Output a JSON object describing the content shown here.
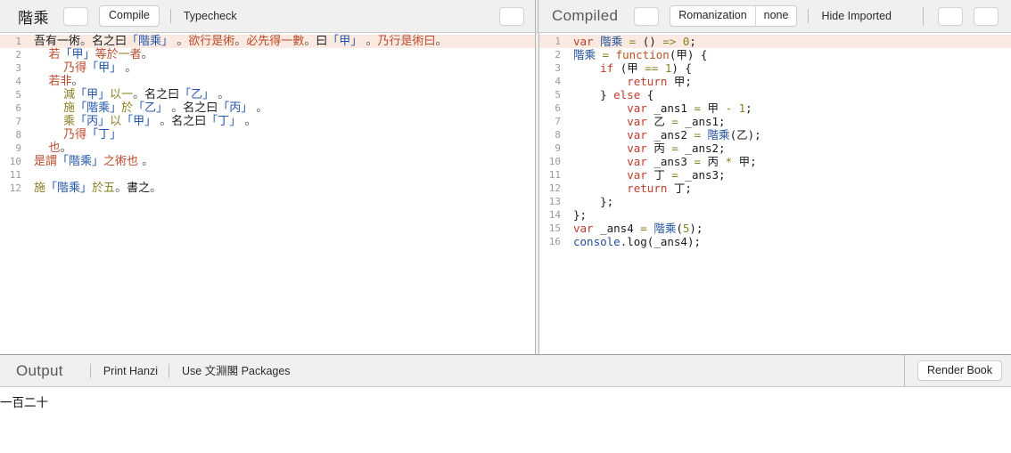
{
  "toolbar_left": {
    "doc_title": "階乘",
    "blank_button": "",
    "compile_label": "Compile",
    "typecheck_label": "Typecheck",
    "right_blank_button": ""
  },
  "toolbar_right": {
    "panel_title": "Compiled",
    "blank_button": "",
    "romanization_label": "Romanization",
    "romanization_value": "none",
    "hide_imported_label": "Hide Imported",
    "blank_button_2": "",
    "blank_button_3": ""
  },
  "left_editor": {
    "active_line": 1,
    "lines": [
      {
        "n": "1",
        "tokens": [
          {
            "t": "吾有一術",
            "c": "pl"
          },
          {
            "t": "。",
            "c": "punc"
          },
          {
            "t": "名之曰",
            "c": "pl"
          },
          {
            "t": "「階乘」",
            "c": "id"
          },
          {
            "t": " 。",
            "c": "punc"
          },
          {
            "t": "欲行是術",
            "c": "kw"
          },
          {
            "t": "。",
            "c": "punc"
          },
          {
            "t": "必先得一數",
            "c": "kw"
          },
          {
            "t": "。",
            "c": "punc"
          },
          {
            "t": "曰",
            "c": "pl"
          },
          {
            "t": "「甲」",
            "c": "id"
          },
          {
            "t": " 。",
            "c": "punc"
          },
          {
            "t": "乃行是術曰",
            "c": "kw"
          },
          {
            "t": "。",
            "c": "punc"
          }
        ]
      },
      {
        "n": "2",
        "tokens": [
          {
            "t": "    ",
            "c": "pl"
          },
          {
            "t": "若",
            "c": "kw"
          },
          {
            "t": "「甲」",
            "c": "id"
          },
          {
            "t": "等於",
            "c": "kw"
          },
          {
            "t": "一",
            "c": "num"
          },
          {
            "t": "者",
            "c": "kw"
          },
          {
            "t": "。",
            "c": "punc"
          }
        ]
      },
      {
        "n": "3",
        "tokens": [
          {
            "t": "        ",
            "c": "pl"
          },
          {
            "t": "乃得",
            "c": "kw"
          },
          {
            "t": "「甲」",
            "c": "id"
          },
          {
            "t": " 。",
            "c": "punc"
          }
        ]
      },
      {
        "n": "4",
        "tokens": [
          {
            "t": "    ",
            "c": "pl"
          },
          {
            "t": "若非",
            "c": "kw"
          },
          {
            "t": "。",
            "c": "punc"
          }
        ]
      },
      {
        "n": "5",
        "tokens": [
          {
            "t": "        ",
            "c": "pl"
          },
          {
            "t": "減",
            "c": "kw2"
          },
          {
            "t": "「甲」",
            "c": "id"
          },
          {
            "t": "以",
            "c": "kw2"
          },
          {
            "t": "一",
            "c": "num"
          },
          {
            "t": "。",
            "c": "punc"
          },
          {
            "t": "名之曰",
            "c": "pl"
          },
          {
            "t": "「乙」",
            "c": "id"
          },
          {
            "t": " 。",
            "c": "punc"
          }
        ]
      },
      {
        "n": "6",
        "tokens": [
          {
            "t": "        ",
            "c": "pl"
          },
          {
            "t": "施",
            "c": "kw2"
          },
          {
            "t": "「階乘」",
            "c": "id"
          },
          {
            "t": "於",
            "c": "kw2"
          },
          {
            "t": "「乙」",
            "c": "id"
          },
          {
            "t": " 。",
            "c": "punc"
          },
          {
            "t": "名之曰",
            "c": "pl"
          },
          {
            "t": "「丙」",
            "c": "id"
          },
          {
            "t": " 。",
            "c": "punc"
          }
        ]
      },
      {
        "n": "7",
        "tokens": [
          {
            "t": "        ",
            "c": "pl"
          },
          {
            "t": "乘",
            "c": "kw2"
          },
          {
            "t": "「丙」",
            "c": "id"
          },
          {
            "t": "以",
            "c": "kw2"
          },
          {
            "t": "「甲」",
            "c": "id"
          },
          {
            "t": " 。",
            "c": "punc"
          },
          {
            "t": "名之曰",
            "c": "pl"
          },
          {
            "t": "「丁」",
            "c": "id"
          },
          {
            "t": " 。",
            "c": "punc"
          }
        ]
      },
      {
        "n": "8",
        "tokens": [
          {
            "t": "        ",
            "c": "pl"
          },
          {
            "t": "乃得",
            "c": "kw"
          },
          {
            "t": "「丁」",
            "c": "id"
          }
        ]
      },
      {
        "n": "9",
        "tokens": [
          {
            "t": "    ",
            "c": "pl"
          },
          {
            "t": "也",
            "c": "kw"
          },
          {
            "t": "。",
            "c": "punc"
          }
        ]
      },
      {
        "n": "10",
        "tokens": [
          {
            "t": "是謂",
            "c": "kw"
          },
          {
            "t": "「階乘」",
            "c": "id"
          },
          {
            "t": "之術也",
            "c": "kw"
          },
          {
            "t": " 。",
            "c": "punc"
          }
        ]
      },
      {
        "n": "11",
        "tokens": []
      },
      {
        "n": "12",
        "tokens": [
          {
            "t": "施",
            "c": "kw2"
          },
          {
            "t": "「階乘」",
            "c": "id"
          },
          {
            "t": "於",
            "c": "kw2"
          },
          {
            "t": "五",
            "c": "num"
          },
          {
            "t": "。",
            "c": "punc"
          },
          {
            "t": "書之",
            "c": "pl"
          },
          {
            "t": "。",
            "c": "punc"
          }
        ]
      }
    ]
  },
  "right_editor": {
    "active_line": 1,
    "lines": [
      {
        "n": "1",
        "tokens": [
          {
            "t": "var ",
            "c": "kw"
          },
          {
            "t": "階乘",
            "c": "id"
          },
          {
            "t": " ",
            "c": "txt"
          },
          {
            "t": "=",
            "c": "op"
          },
          {
            "t": " () ",
            "c": "txt"
          },
          {
            "t": "=>",
            "c": "op"
          },
          {
            "t": " ",
            "c": "txt"
          },
          {
            "t": "0",
            "c": "num"
          },
          {
            "t": ";",
            "c": "txt"
          }
        ]
      },
      {
        "n": "2",
        "tokens": [
          {
            "t": "階乘",
            "c": "id"
          },
          {
            "t": " ",
            "c": "txt"
          },
          {
            "t": "=",
            "c": "op"
          },
          {
            "t": " ",
            "c": "txt"
          },
          {
            "t": "function",
            "c": "fn"
          },
          {
            "t": "(甲) {",
            "c": "txt"
          }
        ]
      },
      {
        "n": "3",
        "tokens": [
          {
            "t": "    ",
            "c": "txt"
          },
          {
            "t": "if",
            "c": "kw"
          },
          {
            "t": " (甲 ",
            "c": "txt"
          },
          {
            "t": "==",
            "c": "op"
          },
          {
            "t": " ",
            "c": "txt"
          },
          {
            "t": "1",
            "c": "num"
          },
          {
            "t": ") {",
            "c": "txt"
          }
        ]
      },
      {
        "n": "4",
        "tokens": [
          {
            "t": "        ",
            "c": "txt"
          },
          {
            "t": "return",
            "c": "kw"
          },
          {
            "t": " 甲;",
            "c": "txt"
          }
        ]
      },
      {
        "n": "5",
        "tokens": [
          {
            "t": "    } ",
            "c": "txt"
          },
          {
            "t": "else",
            "c": "kw"
          },
          {
            "t": " {",
            "c": "txt"
          }
        ]
      },
      {
        "n": "6",
        "tokens": [
          {
            "t": "        ",
            "c": "txt"
          },
          {
            "t": "var",
            "c": "kw"
          },
          {
            "t": " _ans1 ",
            "c": "txt"
          },
          {
            "t": "=",
            "c": "op"
          },
          {
            "t": " 甲 ",
            "c": "txt"
          },
          {
            "t": "-",
            "c": "op"
          },
          {
            "t": " ",
            "c": "txt"
          },
          {
            "t": "1",
            "c": "num"
          },
          {
            "t": ";",
            "c": "txt"
          }
        ]
      },
      {
        "n": "7",
        "tokens": [
          {
            "t": "        ",
            "c": "txt"
          },
          {
            "t": "var",
            "c": "kw"
          },
          {
            "t": " 乙 ",
            "c": "txt"
          },
          {
            "t": "=",
            "c": "op"
          },
          {
            "t": " _ans1;",
            "c": "txt"
          }
        ]
      },
      {
        "n": "8",
        "tokens": [
          {
            "t": "        ",
            "c": "txt"
          },
          {
            "t": "var",
            "c": "kw"
          },
          {
            "t": " _ans2 ",
            "c": "txt"
          },
          {
            "t": "=",
            "c": "op"
          },
          {
            "t": " ",
            "c": "txt"
          },
          {
            "t": "階乘",
            "c": "id"
          },
          {
            "t": "(乙);",
            "c": "txt"
          }
        ]
      },
      {
        "n": "9",
        "tokens": [
          {
            "t": "        ",
            "c": "txt"
          },
          {
            "t": "var",
            "c": "kw"
          },
          {
            "t": " 丙 ",
            "c": "txt"
          },
          {
            "t": "=",
            "c": "op"
          },
          {
            "t": " _ans2;",
            "c": "txt"
          }
        ]
      },
      {
        "n": "10",
        "tokens": [
          {
            "t": "        ",
            "c": "txt"
          },
          {
            "t": "var",
            "c": "kw"
          },
          {
            "t": " _ans3 ",
            "c": "txt"
          },
          {
            "t": "=",
            "c": "op"
          },
          {
            "t": " 丙 ",
            "c": "txt"
          },
          {
            "t": "*",
            "c": "op"
          },
          {
            "t": " 甲;",
            "c": "txt"
          }
        ]
      },
      {
        "n": "11",
        "tokens": [
          {
            "t": "        ",
            "c": "txt"
          },
          {
            "t": "var",
            "c": "kw"
          },
          {
            "t": " 丁 ",
            "c": "txt"
          },
          {
            "t": "=",
            "c": "op"
          },
          {
            "t": " _ans3;",
            "c": "txt"
          }
        ]
      },
      {
        "n": "12",
        "tokens": [
          {
            "t": "        ",
            "c": "txt"
          },
          {
            "t": "return",
            "c": "kw"
          },
          {
            "t": " 丁;",
            "c": "txt"
          }
        ]
      },
      {
        "n": "13",
        "tokens": [
          {
            "t": "    };",
            "c": "txt"
          }
        ]
      },
      {
        "n": "14",
        "tokens": [
          {
            "t": "};",
            "c": "txt"
          }
        ]
      },
      {
        "n": "15",
        "tokens": [
          {
            "t": "var",
            "c": "kw"
          },
          {
            "t": " _ans4 ",
            "c": "txt"
          },
          {
            "t": "=",
            "c": "op"
          },
          {
            "t": " ",
            "c": "txt"
          },
          {
            "t": "階乘",
            "c": "id"
          },
          {
            "t": "(",
            "c": "txt"
          },
          {
            "t": "5",
            "c": "num"
          },
          {
            "t": ");",
            "c": "txt"
          }
        ]
      },
      {
        "n": "16",
        "tokens": [
          {
            "t": "console",
            "c": "id"
          },
          {
            "t": ".log(_ans4);",
            "c": "txt"
          }
        ]
      }
    ]
  },
  "output": {
    "title": "Output",
    "print_hanzi_label": "Print Hanzi",
    "packages_label": "Use 文淵閣 Packages",
    "render_book_label": "Render Book",
    "console_text": "一百二十"
  },
  "colors": {
    "chrome_bg": "#f0f0f0",
    "active_line": "#faeae1",
    "keyword": "#bd4b2b",
    "identifier": "#2255aa",
    "operator": "#8a8024",
    "js_keyword": "#c0392b"
  }
}
